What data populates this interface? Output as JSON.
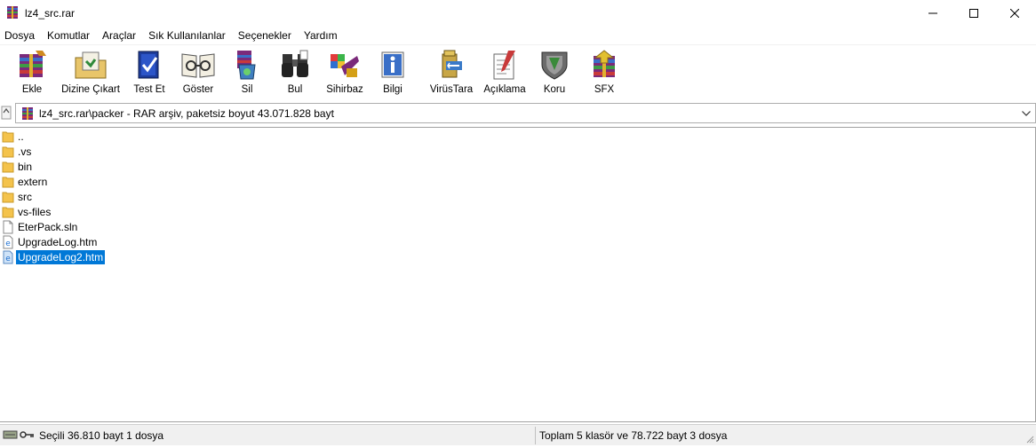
{
  "window": {
    "title": "lz4_src.rar",
    "minimize_icon": "minimize-icon",
    "maximize_icon": "maximize-icon",
    "close_icon": "close-icon"
  },
  "menu": [
    "Dosya",
    "Komutlar",
    "Araçlar",
    "Sık Kullanılanlar",
    "Seçenekler",
    "Yardım"
  ],
  "toolbar": [
    {
      "label": "Ekle",
      "icon": "add-archive-icon"
    },
    {
      "label": "Dizine Çıkart",
      "icon": "extract-folder-icon"
    },
    {
      "label": "Test Et",
      "icon": "test-icon"
    },
    {
      "label": "Göster",
      "icon": "view-icon"
    },
    {
      "label": "Sil",
      "icon": "delete-icon"
    },
    {
      "label": "Bul",
      "icon": "find-binoculars-icon"
    },
    {
      "label": "Sihirbaz",
      "icon": "wizard-icon"
    },
    {
      "label": "Bilgi",
      "icon": "info-icon"
    },
    {
      "label": "VirüsTara",
      "icon": "virus-scan-icon"
    },
    {
      "label": "Açıklama",
      "icon": "comment-icon"
    },
    {
      "label": "Koru",
      "icon": "protect-shield-icon"
    },
    {
      "label": "SFX",
      "icon": "sfx-icon"
    }
  ],
  "address": {
    "text": "lz4_src.rar\\packer - RAR arşiv, paketsiz boyut 43.071.828 bayt"
  },
  "files": [
    {
      "name": "..",
      "type": "folder"
    },
    {
      "name": ".vs",
      "type": "folder"
    },
    {
      "name": "bin",
      "type": "folder"
    },
    {
      "name": "extern",
      "type": "folder"
    },
    {
      "name": "src",
      "type": "folder"
    },
    {
      "name": "vs-files",
      "type": "folder"
    },
    {
      "name": "EterPack.sln",
      "type": "file"
    },
    {
      "name": "UpgradeLog.htm",
      "type": "htm"
    },
    {
      "name": "UpgradeLog2.htm",
      "type": "htm",
      "selected": true
    }
  ],
  "status": {
    "left": "Seçili 36.810 bayt 1 dosya",
    "right": "Toplam 5 klasör ve 78.722 bayt 3 dosya"
  },
  "colors": {
    "selection": "#0078d7",
    "folder": "#f4c34c"
  }
}
